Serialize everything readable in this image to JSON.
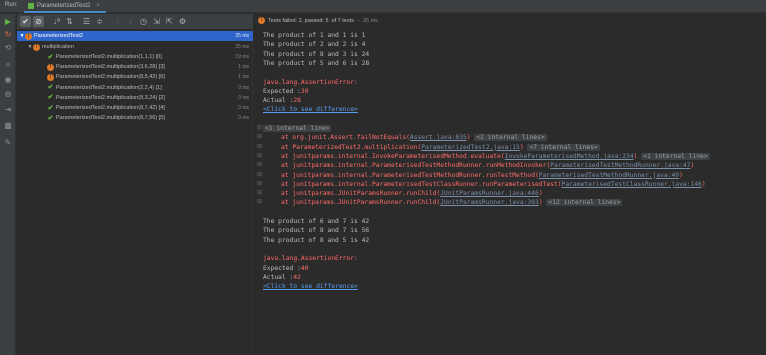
{
  "tabs": {
    "run_label": "Run:",
    "test_tab_label": "ParameterizedTest2",
    "close": "×"
  },
  "left_tools": [
    "run-icon",
    "rerun-failed-icon",
    "toggle-autotest-icon",
    "stop-icon",
    "camera-icon",
    "settings-icon",
    "exit-icon",
    "layout-icon",
    "pin-icon"
  ],
  "toolbar": {
    "icons": [
      "show-passed-icon",
      "show-ignored-icon",
      "sort-alpha-icon",
      "sort-duration-icon",
      "expand-all-icon",
      "collapse-all-icon",
      "prev-failed-icon",
      "next-failed-icon",
      "history-icon",
      "export-icon",
      "import-icon",
      "settings-icon"
    ]
  },
  "tree": {
    "root": {
      "label": "ParameterizedTest2",
      "time": "25 ms"
    },
    "group": {
      "label": "multiplication",
      "time": "25 ms"
    },
    "items": [
      {
        "label": "ParameterizedTest2.multiplication(1,1,1) [0]",
        "time": "19 ms",
        "status": "pass"
      },
      {
        "label": "ParameterizedTest2.multiplication(3,6,28) [3]",
        "time": "1 ms",
        "status": "fail"
      },
      {
        "label": "ParameterizedTest2.multiplication(8,5,42) [6]",
        "time": "1 ms",
        "status": "fail"
      },
      {
        "label": "ParameterizedTest2.multiplication(2,2,4) [1]",
        "time": "0 ms",
        "status": "pass"
      },
      {
        "label": "ParameterizedTest2.multiplication(8,3,24) [2]",
        "time": "0 ms",
        "status": "pass"
      },
      {
        "label": "ParameterizedTest2.multiplication(8,7,42) [4]",
        "time": "0 ms",
        "status": "pass"
      },
      {
        "label": "ParameterizedTest2.multiplication(8,7,56) [5]",
        "time": "0 ms",
        "status": "pass"
      }
    ]
  },
  "status": {
    "failed": "Tests failed: 2, passed: 5",
    "of": "of 7 tests",
    "duration": "25 ms"
  },
  "console": {
    "out1": [
      "The product of 1 and 1 is 1",
      "The product of 2 and 2 is 4",
      "The product of 8 and 3 is 24",
      "The product of 5 and 6 is 28"
    ],
    "error1": {
      "exception": "java.lang.AssertionError:",
      "expected_label": "Expected :",
      "expected_value": "30",
      "actual_label": "Actual   :",
      "actual_value": "28",
      "diff_link": "<Click to see difference>"
    },
    "trace_header": "<1 internal line>",
    "trace": [
      {
        "prefix": "at org.junit.Assert.failNotEquals(",
        "link": "Assert.java:835",
        "suffix": ")",
        "collapsed": "<2 internal lines>"
      },
      {
        "prefix": "at ParameterizedTest2.multiplication(",
        "link": "ParameterizedTest2.java:15",
        "suffix": ")",
        "collapsed": "<7 internal lines>"
      },
      {
        "prefix": "at junitparams.internal.InvokeParameterisedMethod.evaluate(",
        "link": "InvokeParameterisedMethod.java:234",
        "suffix": ")",
        "collapsed": "<1 internal line>"
      },
      {
        "prefix": "at junitparams.internal.ParameterisedTestMethodRunner.runMethodInvoker(",
        "link": "ParameterisedTestMethodRunner.java:47",
        "suffix": ")",
        "collapsed": ""
      },
      {
        "prefix": "at junitparams.internal.ParameterisedTestMethodRunner.runTestMethod(",
        "link": "ParameterisedTestMethodRunner.java:40",
        "suffix": ")",
        "collapsed": ""
      },
      {
        "prefix": "at junitparams.internal.ParameterisedTestClassRunner.runParameterisedTest(",
        "link": "ParameterisedTestClassRunner.java:146",
        "suffix": ")",
        "collapsed": ""
      },
      {
        "prefix": "at junitparams.JUnitParamsRunner.runChild(",
        "link": "JUnitParamsRunner.java:446",
        "suffix": ")",
        "collapsed": ""
      },
      {
        "prefix": "at junitparams.JUnitParamsRunner.runChild(",
        "link": "JUnitParamsRunner.java:393",
        "suffix": ")",
        "collapsed": "<12 internal lines>"
      }
    ],
    "out2": [
      "The product of 6 and 7 is 42",
      "The product of 8 and 7 is 56",
      "The product of 8 and 5 is 42"
    ],
    "error2": {
      "exception": "java.lang.AssertionError:",
      "expected_label": "Expected :",
      "expected_value": "40",
      "actual_label": "Actual   :",
      "actual_value": "42",
      "diff_link": "<Click to see difference>"
    }
  }
}
